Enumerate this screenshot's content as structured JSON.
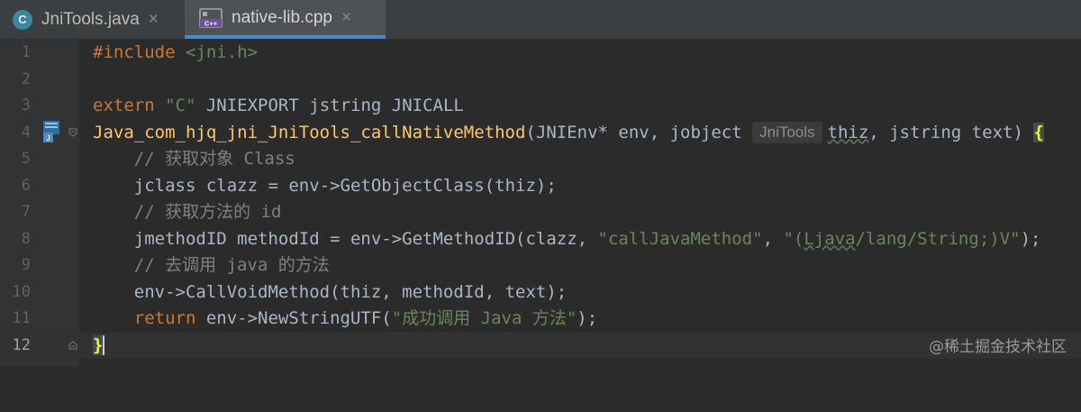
{
  "tabs": [
    {
      "name": "JniTools.java",
      "icon": "java-class-icon",
      "icon_letter": "C",
      "close": "×"
    },
    {
      "name": "native-lib.cpp",
      "icon": "cpp-file-icon",
      "icon_letter": "C++",
      "close": "×",
      "active": true
    }
  ],
  "line_numbers": [
    "1",
    "2",
    "3",
    "4",
    "5",
    "6",
    "7",
    "8",
    "9",
    "10",
    "11",
    "12"
  ],
  "current_line": 12,
  "code": {
    "l1": {
      "kw": "#include",
      "hdr": "<jni.h>"
    },
    "l3": {
      "extern": "extern",
      "c": "\"C\"",
      "rest": " JNIEXPORT jstring JNICALL"
    },
    "l4": {
      "fn": "Java_com_hjq_jni_JniTools_callNativeMethod",
      "p1": "(JNIEnv* env, jobject ",
      "hint": "JniTools",
      "thiz": "thiz",
      "p2": ", jstring text) ",
      "brace": "{"
    },
    "l5": {
      "comment": "// 获取对象 Class"
    },
    "l6": {
      "text": "jclass clazz = env->GetObjectClass(thiz);"
    },
    "l7": {
      "comment": "// 获取方法的 id"
    },
    "l8": {
      "a": "jmethodID methodId = env->GetMethodID(clazz, ",
      "s1": "\"callJavaMethod\"",
      "b": ", ",
      "s2a": "\"(",
      "s2u": "Ljava",
      "s2b": "/lang/String;)V\"",
      "c": ");"
    },
    "l9": {
      "comment": "// 去调用 java 的方法"
    },
    "l10": {
      "text": "env->CallVoidMethod(thiz, methodId, text);"
    },
    "l11": {
      "kw": "return",
      "a": " env->NewStringUTF(",
      "s": "\"成功调用 Java 方法\"",
      "b": ");"
    },
    "l12": {
      "brace": "}"
    }
  },
  "gutter_icon": "jni-bookmark-icon",
  "watermark": "@稀土掘金技术社区",
  "colors": {
    "background": "#2b2b2b",
    "keyword": "#cc7832",
    "string": "#6a8759",
    "comment": "#808080",
    "function": "#ffc66d",
    "text": "#a9b7c6",
    "tab_active_border": "#4a88c7"
  }
}
